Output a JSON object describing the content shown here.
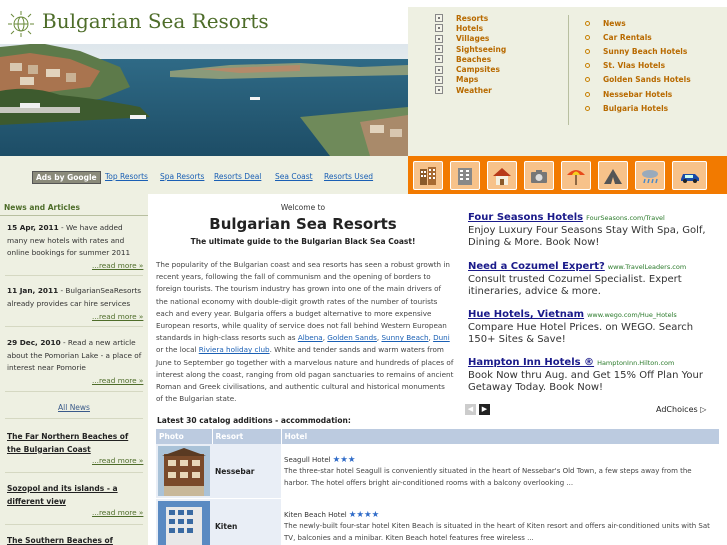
{
  "site": {
    "name": "Bulgarian Sea Resorts"
  },
  "topnav": {
    "col1": [
      "Resorts",
      "Hotels",
      "Villages",
      "Sightseeing",
      "Beaches",
      "Campsites",
      "Maps",
      "Weather"
    ],
    "col2": [
      "News",
      "Car Rentals",
      "Sunny Beach Hotels",
      "St. Vlas Hotels",
      "Golden Sands Hotels",
      "Nessebar Hotels",
      "Bulgaria Hotels"
    ]
  },
  "linkstrip": {
    "ads_label": "Ads by Google",
    "links": [
      "Top Resorts",
      "Spa Resorts",
      "Resorts Deal",
      "Sea Coast",
      "Resorts Used"
    ]
  },
  "icons": [
    "hotel-building-icon",
    "apartment-icon",
    "house-icon",
    "camera-icon",
    "beach-umbrella-icon",
    "tent-icon",
    "weather-icon",
    "car-icon"
  ],
  "left": {
    "news_heading": "News and Articles",
    "news": [
      {
        "date": "15 Apr, 2011",
        "text": " - We have added many new hotels with rates and online bookings for summer 2011",
        "more": "...read more »"
      },
      {
        "date": "11 Jan, 2011",
        "text": " - BulgarianSeaResorts already provides car hire services",
        "more": "...read more »"
      },
      {
        "date": "29 Dec, 2010",
        "text": " - Read a new article about the Pomorian Lake - a place of interest near Pomorie",
        "more": "...read more »"
      }
    ],
    "all_news": "All News",
    "articles": [
      {
        "title": "The Far Northern Beaches of the Bulgarian Coast",
        "more": "...read more »"
      },
      {
        "title": "Sozopol and its islands - a different view",
        "more": "...read more »"
      },
      {
        "title": "The Southern Beaches of",
        "more": ""
      }
    ]
  },
  "main": {
    "welcome": "Welcome to",
    "title": "Bulgarian Sea Resorts",
    "subtitle": "The ultimate guide to the Bulgarian Black Sea Coast!",
    "intro_1": "The popularity of the Bulgarian coast and sea resorts has seen a robust growth in recent years, following the fall of communism and the opening of borders to foreign tourists. The tourism industry has grown into one of the main drivers of the national economy with double-digit growth rates of the number of tourists each and every year. Bulgaria offers a budget alternative to more expensive European resorts, while quality of service does not fall behind Western European standards in high-class resorts such as ",
    "link_albena": "Albena",
    "link_golden_sands": "Golden Sands",
    "link_sunny_beach": "Sunny Beach",
    "link_duni": "Duni",
    "link_riviera": "Riviera holiday club",
    "intro_sep1": ", ",
    "intro_sep2": ", ",
    "intro_sep3": ", ",
    "intro_mid": " or the local ",
    "intro_2": ". White and tender sands and warm waters from June to September go together with a marvelous nature and hundreds of places of interest along the coast, ranging from old pagan sanctuaries to remains of ancient Roman and Greek civilisations, and authentic cultural and historical monuments of the Bulgarian state."
  },
  "ads": [
    {
      "title": "Four Seasons Hotels",
      "url": "FourSeasons.com/Travel",
      "desc": "Enjoy Luxury Four Seasons Stay With Spa, Golf, Dining & More. Book Now!"
    },
    {
      "title": "Need a Cozumel Expert?",
      "url": "www.TravelLeaders.com",
      "desc": "Consult trusted Cozumel Specialist. Expert itineraries, advice & more."
    },
    {
      "title": "Hue Hotels, Vietnam",
      "url": "www.wego.com/Hue_Hotels",
      "desc": "Compare Hue Hotel Prices. on WEGO. Search 150+ Sites & Save!"
    },
    {
      "title": "Hampton Inn Hotels ®",
      "url": "HamptonInn.Hilton.com",
      "desc": "Book Now thru Aug. and Get 15% Off Plan Your Getaway Today. Book Now!"
    }
  ],
  "ad_nav": {
    "prev": "◀",
    "next": "▶",
    "adchoices": "AdChoices ▷"
  },
  "catalog": {
    "heading": "Latest 30 catalog additions - accommodation:",
    "columns": [
      "Photo",
      "Resort",
      "Hotel"
    ],
    "rows": [
      {
        "resort": "Nessebar",
        "hotel": "Seagull Hotel",
        "stars": "★★★",
        "desc": "The three-star hotel Seagull is conveniently situated in the heart of Nessebar's Old Town, a few steps away from the harbor. The hotel offers bright air-conditioned rooms with a balcony overlooking ..."
      },
      {
        "resort": "Kiten",
        "hotel": "Kiten Beach Hotel",
        "stars": "★★★★",
        "desc": "The newly-built four-star hotel Kiten Beach is situated in the heart of Kiten resort and offers air-conditioned units with Sat TV, balconies and a minibar. Kiten Beach hotel features free wireless ..."
      }
    ]
  },
  "colors": {
    "orange": "#f27a00",
    "olive": "#4e6d2a",
    "nav_bg": "#eef0e2",
    "link_blue": "#1a5fb4",
    "table_header": "#bccbe0"
  }
}
